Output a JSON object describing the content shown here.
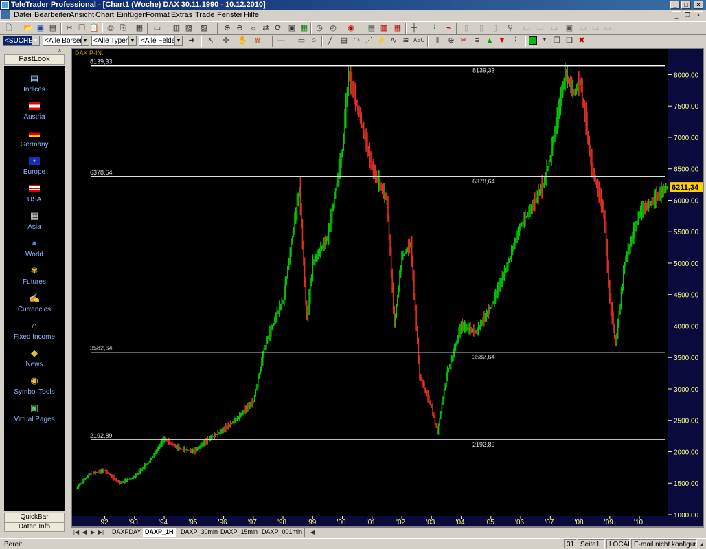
{
  "window": {
    "title": "TeleTrader Professional - [Chart1 (Woche)  DAX 30.11.1990 - 10.12.2010]"
  },
  "menu": {
    "items": [
      "Datei",
      "Bearbeiten",
      "Ansicht",
      "Chart",
      "Einfügen",
      "Format",
      "Extras",
      "Trade",
      "Fenster",
      "Hilfe"
    ]
  },
  "toolbar2": {
    "search_value": "<SUCHE>",
    "exchanges_value": "<Alle Börsen>",
    "types_value": "<Alle Typen>",
    "fields_value": "<Alle Felder>"
  },
  "sidebar": {
    "title": "FastLook",
    "items": [
      {
        "label": "Indices",
        "icon": "indices-icon"
      },
      {
        "label": "Austria",
        "icon": "austria-flag-icon"
      },
      {
        "label": "Germany",
        "icon": "germany-flag-icon"
      },
      {
        "label": "Europe",
        "icon": "europe-flag-icon"
      },
      {
        "label": "USA",
        "icon": "usa-flag-icon"
      },
      {
        "label": "Asia",
        "icon": "asia-icon"
      },
      {
        "label": "World",
        "icon": "globe-icon"
      },
      {
        "label": "Futures",
        "icon": "futures-icon"
      },
      {
        "label": "Currencies",
        "icon": "currencies-icon"
      },
      {
        "label": "Fixed Income",
        "icon": "bank-icon"
      },
      {
        "label": "News",
        "icon": "news-icon"
      },
      {
        "label": "Symbol Tools",
        "icon": "symbol-tools-icon"
      },
      {
        "label": "Virtual Pages",
        "icon": "virtual-pages-icon"
      }
    ],
    "quickbar": "QuickBar",
    "dateninfo": "Daten Info"
  },
  "chart_data": {
    "type": "line",
    "instrument_label": "DAX P-IN.",
    "x": [
      1991.0,
      1991.5,
      1992.0,
      1992.5,
      1993.0,
      1993.5,
      1994.0,
      1994.5,
      1995.0,
      1995.5,
      1996.0,
      1996.5,
      1997.0,
      1997.4,
      1997.8,
      1998.0,
      1998.55,
      1998.8,
      1999.0,
      1999.5,
      2000.0,
      2000.2,
      2000.6,
      2001.0,
      2001.5,
      2001.75,
      2002.0,
      2002.3,
      2002.6,
      2003.0,
      2003.2,
      2003.5,
      2004.0,
      2004.5,
      2005.0,
      2005.5,
      2006.0,
      2006.4,
      2006.8,
      2007.0,
      2007.5,
      2007.8,
      2008.0,
      2008.4,
      2008.8,
      2009.0,
      2009.2,
      2009.5,
      2010.0,
      2010.5,
      2010.93
    ],
    "values": [
      1400,
      1650,
      1700,
      1500,
      1600,
      1850,
      2200,
      2050,
      2000,
      2200,
      2350,
      2550,
      2800,
      3700,
      4200,
      4400,
      6200,
      4100,
      5000,
      5400,
      6800,
      8000,
      7300,
      6500,
      6000,
      4000,
      5100,
      5300,
      3200,
      2700,
      2300,
      3200,
      4000,
      3900,
      4300,
      4900,
      5600,
      5900,
      6300,
      6700,
      8000,
      7700,
      7900,
      6500,
      5800,
      4400,
      3700,
      5000,
      5800,
      6000,
      6211.34
    ],
    "last_value": "6211,34",
    "xticks": [
      "'92",
      "'93",
      "'94",
      "'95",
      "'96",
      "'97",
      "'98",
      "'99",
      "'00",
      "'01",
      "'02",
      "'03",
      "'04",
      "'05",
      "'06",
      "'07",
      "'08",
      "'09",
      "'10"
    ],
    "yticks": [
      "8000,00",
      "7500,00",
      "7000,00",
      "6500,00",
      "6000,00",
      "5500,00",
      "5000,00",
      "4500,00",
      "4000,00",
      "3500,00",
      "3000,00",
      "2500,00",
      "2000,00",
      "1500,00",
      "1000,00"
    ],
    "ylim": [
      1000,
      8300
    ],
    "hlines": [
      {
        "value": 8139.33,
        "label": "8139,33"
      },
      {
        "value": 6378.64,
        "label": "6378,64"
      },
      {
        "value": 3582.64,
        "label": "3582,64"
      },
      {
        "value": 2192.89,
        "label": "2192,89"
      }
    ],
    "colors": {
      "up": "#00c800",
      "down": "#e03020",
      "line": "#ffffff",
      "axis_bg": "#0a0a3c",
      "axis_text": "#ffff80"
    }
  },
  "tabs": [
    "DAXPDAY",
    "DAXP_1H",
    "DAXP_30min",
    "DAXP_15min",
    "DAXP_001min"
  ],
  "active_tab": "DAXP_1H",
  "status": {
    "left": "Bereit",
    "num": "31",
    "page": "Seite1",
    "local": "LOCAL",
    "email": "E-mail nicht konfiguriert."
  }
}
